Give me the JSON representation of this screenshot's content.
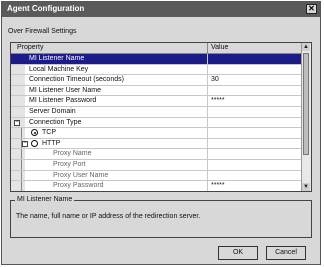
{
  "window": {
    "title": "Agent Configuration",
    "close_glyph": "✕"
  },
  "subtitle": "Over Firewall Settings",
  "grid": {
    "headers": {
      "property": "Property",
      "value": "Value"
    },
    "rows": [
      {
        "name": "MI Listener Name",
        "value": "",
        "selected": true
      },
      {
        "name": "Local Machine Key",
        "value": ""
      },
      {
        "name": "Connection Timeout (seconds)",
        "value": "30"
      },
      {
        "name": "MI Listener User Name",
        "value": ""
      },
      {
        "name": "MI Listener Password",
        "value": "*****"
      },
      {
        "name": "Server Domain",
        "value": ""
      },
      {
        "name": "Connection Type",
        "value": "",
        "toggle": "−"
      },
      {
        "name": "TCP",
        "value": "",
        "radio": "on"
      },
      {
        "name": "HTTP",
        "value": "",
        "radio": "off",
        "toggle": "−"
      },
      {
        "name": "Proxy Name",
        "value": "",
        "sub": true
      },
      {
        "name": "Proxy Port",
        "value": "",
        "sub": true
      },
      {
        "name": "Proxy User Name",
        "value": "",
        "sub": true
      },
      {
        "name": "Proxy Password",
        "value": "*****",
        "sub": true
      }
    ],
    "scroll_up": "▲",
    "scroll_down": "▼"
  },
  "description": {
    "caption": "MI Listener Name",
    "text": "The name, full name or IP address of the redirection server."
  },
  "buttons": {
    "ok": "OK",
    "cancel": "Cancel"
  },
  "icons": {
    "close": "close-icon",
    "scroll_up": "arrow-up-icon",
    "scroll_down": "arrow-down-icon"
  }
}
